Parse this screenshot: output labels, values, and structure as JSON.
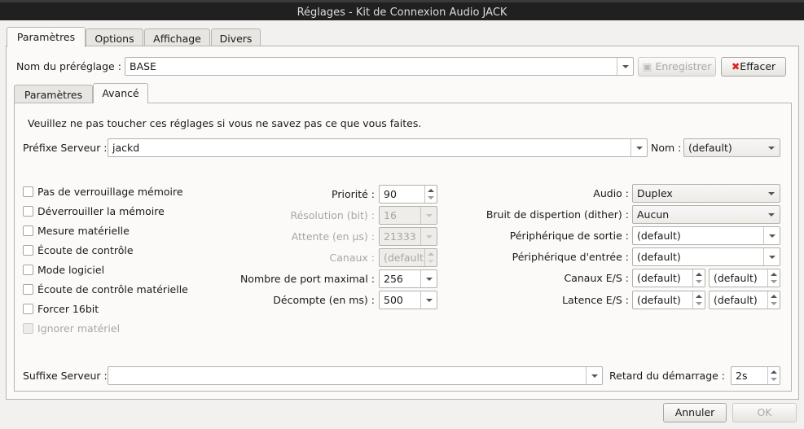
{
  "window": {
    "title": "Réglages - Kit de Connexion Audio JACK"
  },
  "outer_tabs": [
    "Paramètres",
    "Options",
    "Affichage",
    "Divers"
  ],
  "preset": {
    "label": "Nom du préréglage :",
    "value": "BASE",
    "save": "Enregistrer",
    "delete": "Effacer"
  },
  "inner_tabs": [
    "Paramètres",
    "Avancé"
  ],
  "warning": "Veuillez ne pas toucher ces réglages si vous ne savez pas ce que vous faites.",
  "server_prefix": {
    "label": "Préfixe Serveur :",
    "value": "jackd"
  },
  "name": {
    "label": "Nom :",
    "value": "(default)"
  },
  "checkboxes": [
    {
      "label": "Pas de verrouillage mémoire",
      "checked": false,
      "enabled": true
    },
    {
      "label": "Déverrouiller la mémoire",
      "checked": false,
      "enabled": true
    },
    {
      "label": "Mesure matérielle",
      "checked": false,
      "enabled": true
    },
    {
      "label": "Écoute de contrôle",
      "checked": false,
      "enabled": true
    },
    {
      "label": "Mode logiciel",
      "checked": false,
      "enabled": true
    },
    {
      "label": "Écoute de contrôle matérielle",
      "checked": false,
      "enabled": true
    },
    {
      "label": "Forcer 16bit",
      "checked": false,
      "enabled": true
    },
    {
      "label": "Ignorer matériel",
      "checked": false,
      "enabled": false
    }
  ],
  "mid": [
    {
      "label": "Priorité :",
      "value": "90"
    },
    {
      "label": "Résolution (bit) :",
      "value": "16"
    },
    {
      "label": "Attente (en µs) :",
      "value": "21333"
    },
    {
      "label": "Canaux :",
      "value": "(default)"
    },
    {
      "label": "Nombre de port maximal :",
      "value": "256"
    },
    {
      "label": "Décompte (en ms) :",
      "value": "500"
    }
  ],
  "right": [
    {
      "label": "Audio :",
      "value": "Duplex"
    },
    {
      "label": "Bruit de dispertion (dither) :",
      "value": "Aucun"
    },
    {
      "label": "Périphérique de sortie :",
      "value": "(default)"
    },
    {
      "label": "Périphérique d'entrée :",
      "value": "(default)"
    },
    {
      "label": "Canaux E/S :",
      "value": "(default)",
      "value2": "(default)"
    },
    {
      "label": "Latence E/S :",
      "value": "(default)",
      "value2": "(default)"
    }
  ],
  "server_suffix": {
    "label": "Suffixe Serveur :",
    "value": ""
  },
  "start_delay": {
    "label": "Retard du démarrage :",
    "value": "2s"
  },
  "buttons": {
    "cancel": "Annuler",
    "ok": "OK"
  }
}
